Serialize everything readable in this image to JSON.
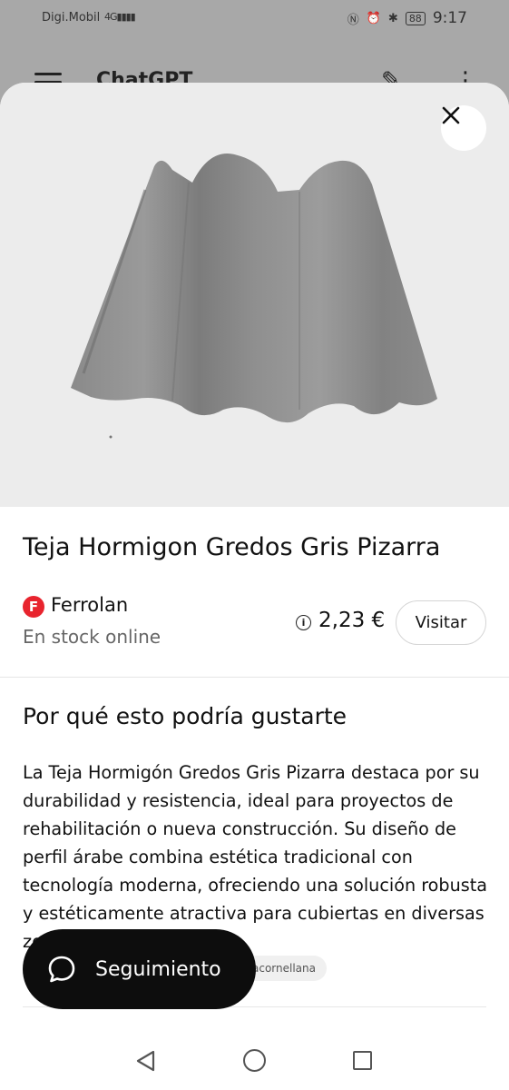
{
  "status_bar": {
    "carrier": "Digi.Mobil",
    "signal": "4G▮▮▮▮",
    "battery": "88",
    "time": "9:17"
  },
  "background_app": {
    "title": "ChatGPT"
  },
  "product": {
    "title": "Teja Hormigon Gredos Gris Pizarra",
    "store": "Ferrolan",
    "store_logo_letter": "F",
    "availability": "En stock online",
    "price": "2,23 €",
    "visit_label": "Visitar"
  },
  "section": {
    "title": "Por qué esto podría gustarte",
    "description": "La Teja Hormigón Gredos Gris Pizarra destaca por su durabilidad y resistencia, ideal para proyectos de rehabilitación o nueva construcción. Su diseño de perfil árabe combina estética tradicional con tecnología moderna, ofreciendo una solución robusta y estéticamente atractiva para cubiertas en diversas zonas",
    "source_chip": "acornellana"
  },
  "follow_button": {
    "label": "Seguimiento"
  },
  "icons": {
    "close": "close-icon",
    "info": "info-icon",
    "chat": "chat-bubble-icon",
    "back": "nav-back-icon",
    "home": "nav-home-icon",
    "recents": "nav-recents-icon"
  }
}
